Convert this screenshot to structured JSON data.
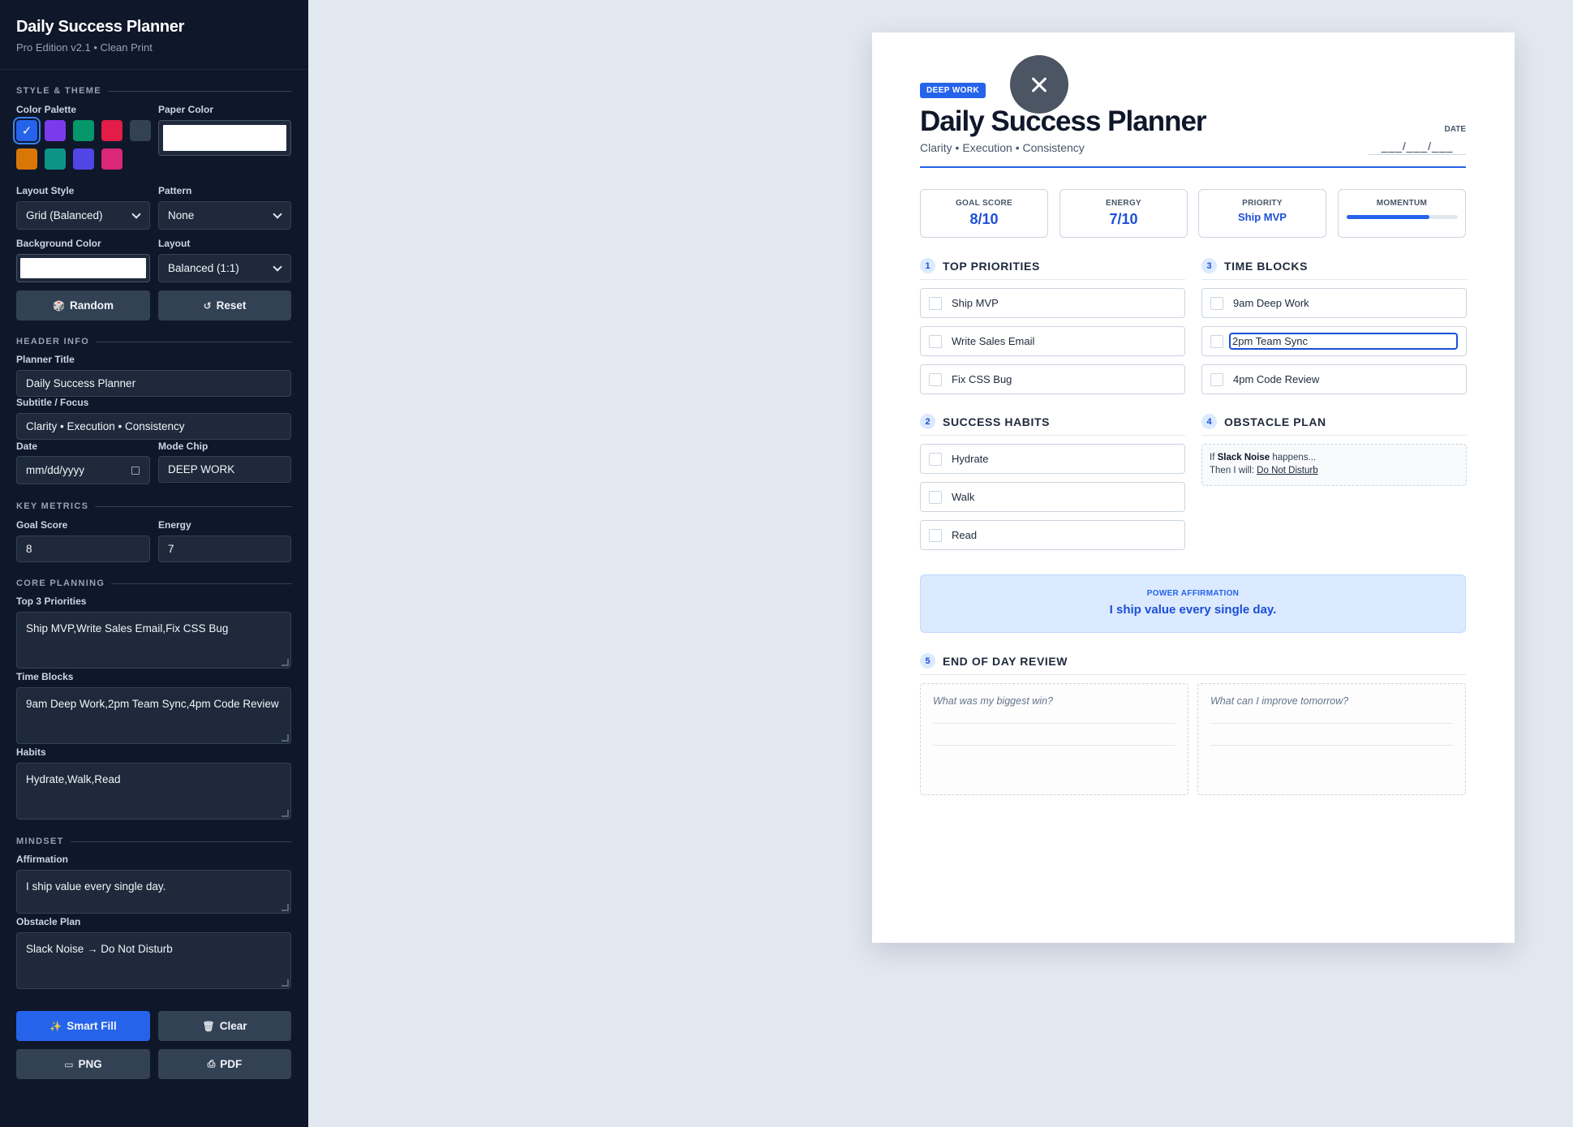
{
  "sidebar": {
    "title": "Daily Success Planner",
    "subtitle": "Pro Edition v2.1 • Clean Print",
    "sections": {
      "style": "STYLE & THEME",
      "header": "HEADER INFO",
      "metrics": "KEY METRICS",
      "core": "CORE PLANNING",
      "mindset": "MINDSET"
    },
    "labels": {
      "palette": "Color Palette",
      "paper_color": "Paper Color",
      "layout_style": "Layout Style",
      "pattern": "Pattern",
      "bg_color": "Background Color",
      "layout": "Layout",
      "planner_title": "Planner Title",
      "subtitle_focus": "Subtitle / Focus",
      "date": "Date",
      "mode_chip": "Mode Chip",
      "goal_score": "Goal Score",
      "energy": "Energy",
      "priorities": "Top 3 Priorities",
      "time_blocks": "Time Blocks",
      "habits": "Habits",
      "affirmation": "Affirmation",
      "obstacle": "Obstacle Plan"
    },
    "palette": [
      "#2563eb",
      "#7c3aed",
      "#059669",
      "#e11d48",
      "#334155",
      "#d97706",
      "#0d9488",
      "#4f46e5",
      "#db2777"
    ],
    "palette_check": "✓",
    "values": {
      "layout_style": "Grid (Balanced)",
      "pattern": "None",
      "layout": "Balanced (1:1)",
      "planner_title": "Daily Success Planner",
      "subtitle_focus": "Clarity • Execution • Consistency",
      "date": "mm/dd/yyyy",
      "mode_chip": "DEEP WORK",
      "goal_score": "8",
      "energy": "7",
      "priorities": "Ship MVP,Write Sales Email,Fix CSS Bug",
      "time_blocks": "9am Deep Work,2pm Team Sync,4pm Code Review",
      "habits": "Hydrate,Walk,Read",
      "affirmation": "I ship value every single day.",
      "obstacle": "Slack Noise → Do Not Disturb"
    },
    "buttons": {
      "random": "Random",
      "reset": "Reset",
      "smart_fill": "Smart Fill",
      "clear": "Clear",
      "png": "PNG",
      "pdf": "PDF"
    },
    "button_icons": {
      "random": "🎲",
      "reset": "↺",
      "smart_fill": "✨",
      "clear": "🗑",
      "png": "▭",
      "pdf": "⎙"
    }
  },
  "planner": {
    "chip": "DEEP WORK",
    "title": "Daily Success Planner",
    "subtitle": "Clarity • Execution • Consistency",
    "date_label": "DATE",
    "date_value": "___/___/___",
    "metrics": [
      {
        "label": "GOAL SCORE",
        "value": "8/10"
      },
      {
        "label": "ENERGY",
        "value": "7/10"
      },
      {
        "label": "PRIORITY",
        "value": "Ship MVP"
      },
      {
        "label": "MOMENTUM",
        "progress": 0.75
      }
    ],
    "sections": {
      "priorities": {
        "num": "1",
        "title": "TOP PRIORITIES",
        "items": [
          "Ship MVP",
          "Write Sales Email",
          "Fix CSS Bug"
        ]
      },
      "habits": {
        "num": "2",
        "title": "SUCCESS HABITS",
        "items": [
          "Hydrate",
          "Walk",
          "Read"
        ]
      },
      "time_blocks": {
        "num": "3",
        "title": "TIME BLOCKS",
        "items": [
          "9am Deep Work",
          "2pm Team Sync",
          "4pm Code Review"
        ]
      },
      "obstacle": {
        "num": "4",
        "title": "OBSTACLE PLAN",
        "if_prefix": "If",
        "trigger": "Slack Noise",
        "if_suffix": "happens...",
        "then_prefix": "Then I will:",
        "action": "Do Not Disturb"
      },
      "review": {
        "num": "5",
        "title": "END OF DAY REVIEW",
        "q1": "What was my biggest win?",
        "q2": "What can I improve tomorrow?"
      }
    },
    "affirmation": {
      "label": "POWER AFFIRMATION",
      "text": "I ship value every single day."
    }
  }
}
